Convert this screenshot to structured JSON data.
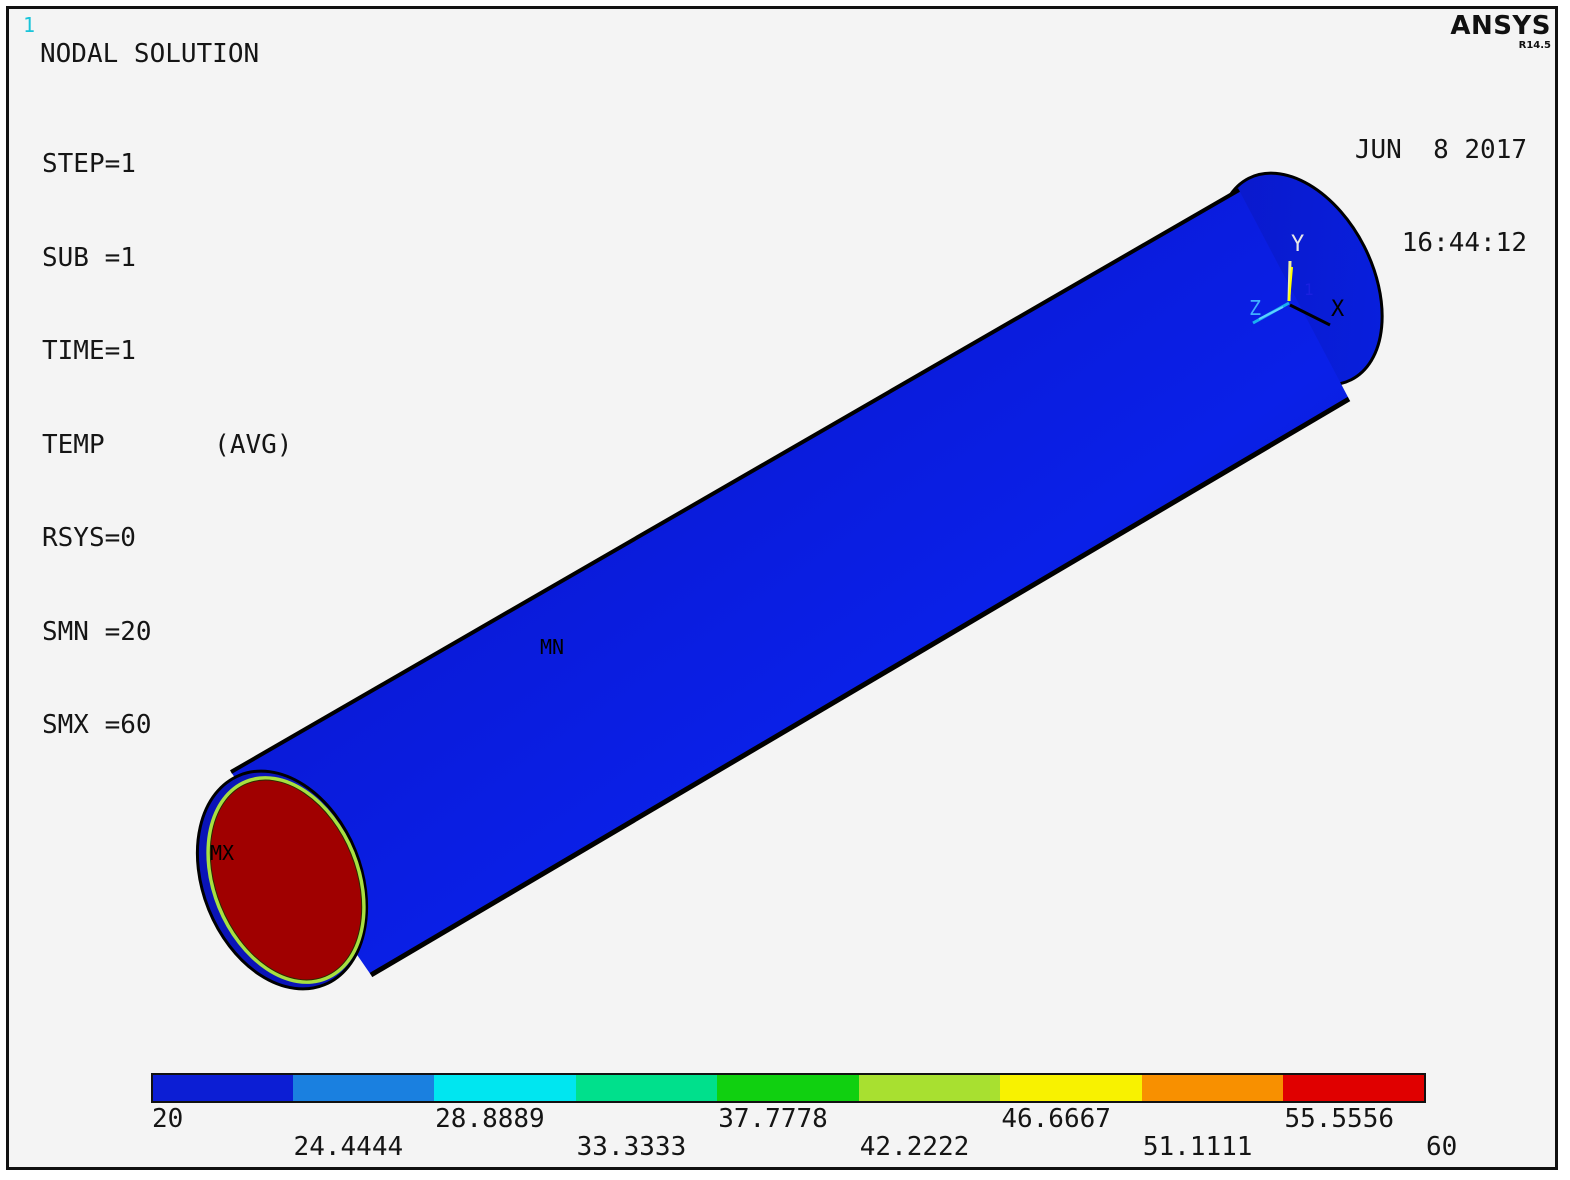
{
  "window": {
    "number": "1",
    "brand": "ANSYS",
    "version": "R14.5"
  },
  "title": "NODAL SOLUTION",
  "info": [
    "STEP=1",
    "SUB =1",
    "TIME=1",
    "TEMP       (AVG)",
    "RSYS=0",
    "SMN =20",
    "SMX =60"
  ],
  "date": "JUN  8 2017",
  "time": "16:44:12",
  "labels": {
    "min": "MN",
    "max": "MX"
  },
  "triad": {
    "y": "Y",
    "z": "Z",
    "x": "X",
    "node": "1"
  },
  "colors": {
    "background": "#f4f4f4",
    "cylinder_body": "#0a1ee0",
    "end_face": "#a00000",
    "end_rim": "#a8e040"
  },
  "legend": {
    "values": [
      "20",
      "24.4444",
      "28.8889",
      "33.3333",
      "37.7778",
      "42.2222",
      "46.6667",
      "51.1111",
      "55.5556",
      "60"
    ],
    "colors": [
      "#0c1ed4",
      "#1a80e0",
      "#00e6f0",
      "#00e08c",
      "#10d010",
      "#a8e030",
      "#f8f200",
      "#f89000",
      "#e00000"
    ]
  }
}
